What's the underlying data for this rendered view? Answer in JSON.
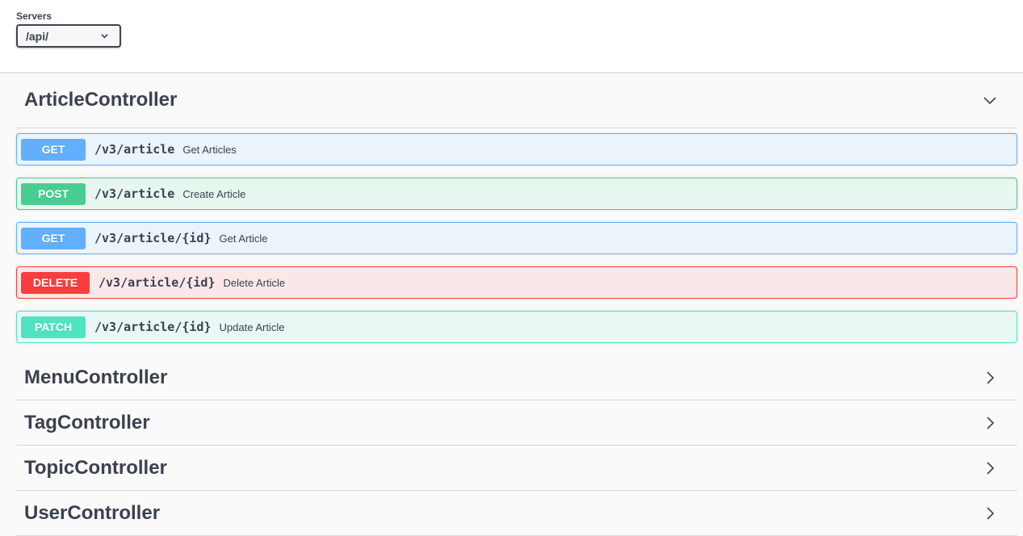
{
  "servers": {
    "label": "Servers",
    "selected": "/api/"
  },
  "tags": [
    {
      "name": "ArticleController",
      "expanded": true,
      "toggle_icon": "chevron-down-icon",
      "operations": [
        {
          "method": "GET",
          "path": "/v3/article",
          "summary": "Get Articles"
        },
        {
          "method": "POST",
          "path": "/v3/article",
          "summary": "Create Article"
        },
        {
          "method": "GET",
          "path": "/v3/article/{id}",
          "summary": "Get Article"
        },
        {
          "method": "DELETE",
          "path": "/v3/article/{id}",
          "summary": "Delete Article"
        },
        {
          "method": "PATCH",
          "path": "/v3/article/{id}",
          "summary": "Update Article"
        }
      ]
    },
    {
      "name": "MenuController",
      "expanded": false,
      "toggle_icon": "chevron-right-icon"
    },
    {
      "name": "TagController",
      "expanded": false,
      "toggle_icon": "chevron-right-icon"
    },
    {
      "name": "TopicController",
      "expanded": false,
      "toggle_icon": "chevron-right-icon"
    },
    {
      "name": "UserController",
      "expanded": false,
      "toggle_icon": "chevron-right-icon"
    }
  ],
  "colors": {
    "get": "#61affe",
    "post": "#49cc90",
    "delete": "#f93e3e",
    "patch": "#50e3c2",
    "text": "#3b4151"
  }
}
